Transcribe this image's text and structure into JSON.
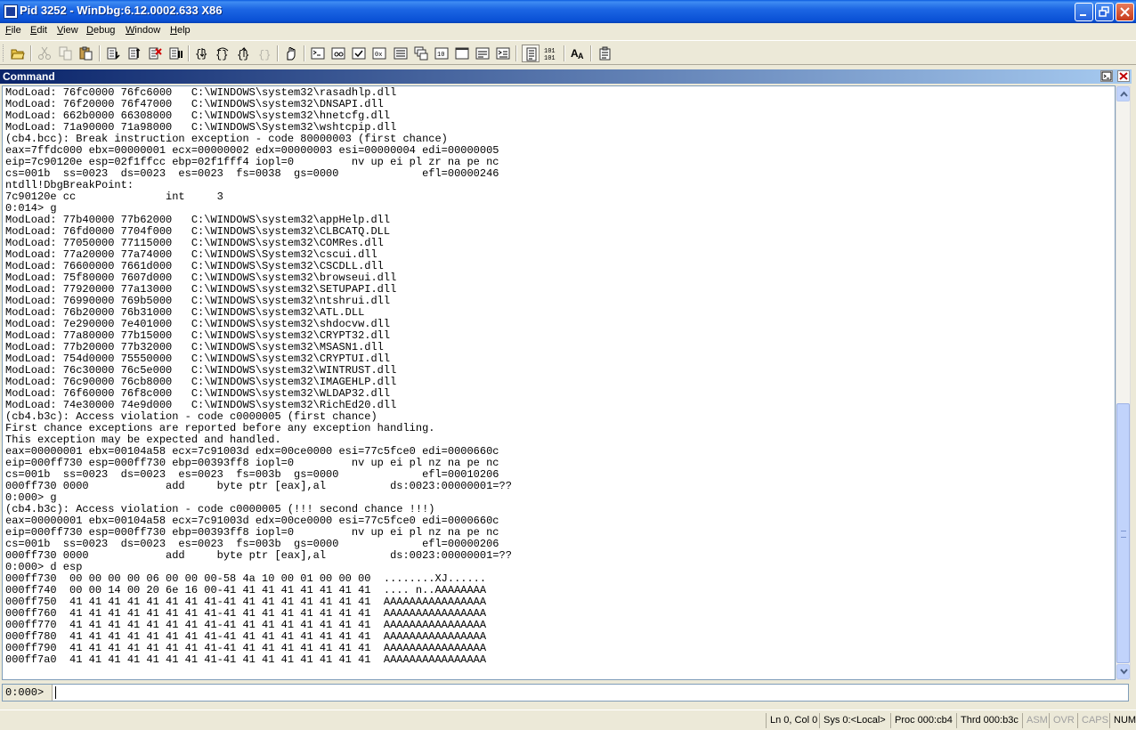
{
  "window": {
    "title": "Pid 3252 - WinDbg:6.12.0002.633 X86",
    "minimize_label": "_",
    "maximize_label": "□",
    "close_label": "×"
  },
  "menu": {
    "file": "File",
    "edit": "Edit",
    "view": "View",
    "debug": "Debug",
    "window": "Window",
    "help": "Help"
  },
  "toolbar": {
    "buttons": [
      {
        "icon": "open-icon",
        "enabled": true
      },
      {
        "icon": "cut-icon",
        "enabled": false
      },
      {
        "icon": "copy-icon",
        "enabled": false
      },
      {
        "icon": "paste-icon",
        "enabled": true
      },
      {
        "icon": "go-icon",
        "enabled": true
      },
      {
        "icon": "restart-icon",
        "enabled": true
      },
      {
        "icon": "stop-debugging-icon",
        "enabled": true
      },
      {
        "icon": "break-icon",
        "enabled": true
      },
      {
        "icon": "step-into-icon",
        "enabled": true
      },
      {
        "icon": "step-over-icon",
        "enabled": true
      },
      {
        "icon": "step-out-icon",
        "enabled": true
      },
      {
        "icon": "run-to-cursor-icon",
        "enabled": false
      },
      {
        "icon": "insert-breakpoint-icon",
        "enabled": true
      },
      {
        "icon": "command-window-icon",
        "enabled": true
      },
      {
        "icon": "watch-window-icon",
        "enabled": true
      },
      {
        "icon": "locals-window-icon",
        "enabled": true
      },
      {
        "icon": "registers-window-icon",
        "enabled": true
      },
      {
        "icon": "memory-window-icon",
        "enabled": true
      },
      {
        "icon": "call-stack-window-icon",
        "enabled": true
      },
      {
        "icon": "disassembly-window-icon",
        "enabled": true
      },
      {
        "icon": "scratch-pad-icon",
        "enabled": true
      },
      {
        "icon": "processes-threads-icon",
        "enabled": true
      },
      {
        "icon": "command-browser-icon",
        "enabled": true
      },
      {
        "icon": "source-mode-icon",
        "enabled": true
      },
      {
        "icon": "hex-mode-icon",
        "enabled": true,
        "label": "101\n101"
      },
      {
        "icon": "font-icon",
        "enabled": true,
        "label": "AA"
      },
      {
        "icon": "options-icon",
        "enabled": true
      }
    ]
  },
  "command_window": {
    "title": "Command",
    "output": "ModLoad: 76fc0000 76fc6000   C:\\WINDOWS\\system32\\rasadhlp.dll\nModLoad: 76f20000 76f47000   C:\\WINDOWS\\system32\\DNSAPI.dll\nModLoad: 662b0000 66308000   C:\\WINDOWS\\system32\\hnetcfg.dll\nModLoad: 71a90000 71a98000   C:\\WINDOWS\\System32\\wshtcpip.dll\n(cb4.bcc): Break instruction exception - code 80000003 (first chance)\neax=7ffdc000 ebx=00000001 ecx=00000002 edx=00000003 esi=00000004 edi=00000005\neip=7c90120e esp=02f1ffcc ebp=02f1fff4 iopl=0         nv up ei pl zr na pe nc\ncs=001b  ss=0023  ds=0023  es=0023  fs=0038  gs=0000             efl=00000246\nntdll!DbgBreakPoint:\n7c90120e cc              int     3\n0:014> g\nModLoad: 77b40000 77b62000   C:\\WINDOWS\\system32\\appHelp.dll\nModLoad: 76fd0000 7704f000   C:\\WINDOWS\\system32\\CLBCATQ.DLL\nModLoad: 77050000 77115000   C:\\WINDOWS\\system32\\COMRes.dll\nModLoad: 77a20000 77a74000   C:\\WINDOWS\\System32\\cscui.dll\nModLoad: 76600000 7661d000   C:\\WINDOWS\\System32\\CSCDLL.dll\nModLoad: 75f80000 7607d000   C:\\WINDOWS\\system32\\browseui.dll\nModLoad: 77920000 77a13000   C:\\WINDOWS\\system32\\SETUPAPI.dll\nModLoad: 76990000 769b5000   C:\\WINDOWS\\system32\\ntshrui.dll\nModLoad: 76b20000 76b31000   C:\\WINDOWS\\system32\\ATL.DLL\nModLoad: 7e290000 7e401000   C:\\WINDOWS\\system32\\shdocvw.dll\nModLoad: 77a80000 77b15000   C:\\WINDOWS\\system32\\CRYPT32.dll\nModLoad: 77b20000 77b32000   C:\\WINDOWS\\system32\\MSASN1.dll\nModLoad: 754d0000 75550000   C:\\WINDOWS\\system32\\CRYPTUI.dll\nModLoad: 76c30000 76c5e000   C:\\WINDOWS\\system32\\WINTRUST.dll\nModLoad: 76c90000 76cb8000   C:\\WINDOWS\\system32\\IMAGEHLP.dll\nModLoad: 76f60000 76f8c000   C:\\WINDOWS\\system32\\WLDAP32.dll\nModLoad: 74e30000 74e9d000   C:\\WINDOWS\\system32\\RichEd20.dll\n(cb4.b3c): Access violation - code c0000005 (first chance)\nFirst chance exceptions are reported before any exception handling.\nThis exception may be expected and handled.\neax=00000001 ebx=00104a58 ecx=7c91003d edx=00ce0000 esi=77c5fce0 edi=0000660c\neip=000ff730 esp=000ff730 ebp=00393ff8 iopl=0         nv up ei pl nz na pe nc\ncs=001b  ss=0023  ds=0023  es=0023  fs=003b  gs=0000             efl=00010206\n000ff730 0000            add     byte ptr [eax],al          ds:0023:00000001=??\n0:000> g\n(cb4.b3c): Access violation - code c0000005 (!!! second chance !!!)\neax=00000001 ebx=00104a58 ecx=7c91003d edx=00ce0000 esi=77c5fce0 edi=0000660c\neip=000ff730 esp=000ff730 ebp=00393ff8 iopl=0         nv up ei pl nz na pe nc\ncs=001b  ss=0023  ds=0023  es=0023  fs=003b  gs=0000             efl=00000206\n000ff730 0000            add     byte ptr [eax],al          ds:0023:00000001=??\n0:000> d esp\n000ff730  00 00 00 00 06 00 00 00-58 4a 10 00 01 00 00 00  ........XJ......\n000ff740  00 00 14 00 20 6e 16 00-41 41 41 41 41 41 41 41  .... n..AAAAAAAA\n000ff750  41 41 41 41 41 41 41 41-41 41 41 41 41 41 41 41  AAAAAAAAAAAAAAAA\n000ff760  41 41 41 41 41 41 41 41-41 41 41 41 41 41 41 41  AAAAAAAAAAAAAAAA\n000ff770  41 41 41 41 41 41 41 41-41 41 41 41 41 41 41 41  AAAAAAAAAAAAAAAA\n000ff780  41 41 41 41 41 41 41 41-41 41 41 41 41 41 41 41  AAAAAAAAAAAAAAAA\n000ff790  41 41 41 41 41 41 41 41-41 41 41 41 41 41 41 41  AAAAAAAAAAAAAAAA\n000ff7a0  41 41 41 41 41 41 41 41-41 41 41 41 41 41 41 41  AAAAAAAAAAAAAAAA",
    "prompt": "0:000>",
    "input_value": ""
  },
  "status_bar": {
    "position": "Ln 0, Col 0",
    "system": "Sys 0:<Local>",
    "process": "Proc 000:cb4",
    "thread": "Thrd 000:b3c",
    "asm": "ASM",
    "ovr": "OVR",
    "caps": "CAPS",
    "num": "NUM"
  }
}
